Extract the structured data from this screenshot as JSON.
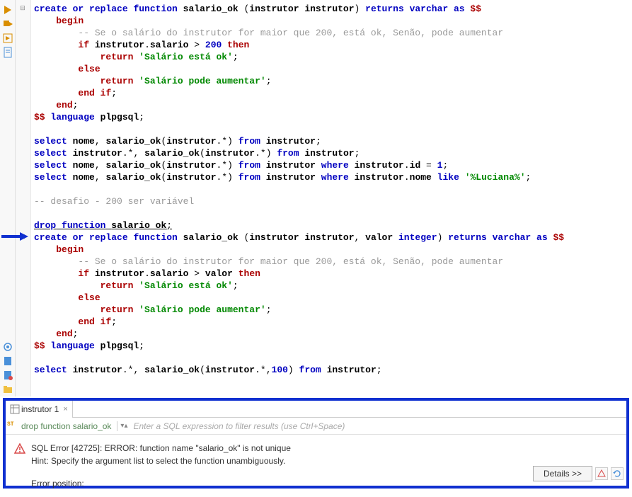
{
  "editor": {
    "lines": [
      [
        [
          "kw-blue",
          "create or replace"
        ],
        [
          "plain",
          " "
        ],
        [
          "kw-blue",
          "function"
        ],
        [
          "plain",
          " "
        ],
        [
          "ident",
          "salario_ok"
        ],
        [
          "plain",
          " ("
        ],
        [
          "ident",
          "instrutor"
        ],
        [
          "plain",
          " "
        ],
        [
          "ident",
          "instrutor"
        ],
        [
          "plain",
          ") "
        ],
        [
          "kw-blue",
          "returns"
        ],
        [
          "plain",
          " "
        ],
        [
          "kw-blue",
          "varchar"
        ],
        [
          "plain",
          " "
        ],
        [
          "kw-blue",
          "as"
        ],
        [
          "plain",
          " "
        ],
        [
          "dollar",
          "$$"
        ]
      ],
      [
        [
          "plain",
          "    "
        ],
        [
          "kw-red",
          "begin"
        ]
      ],
      [
        [
          "plain",
          "        "
        ],
        [
          "comment",
          "-- Se o salário do instrutor for maior que 200, está ok, Senão, pode aumentar"
        ]
      ],
      [
        [
          "plain",
          "        "
        ],
        [
          "kw-red",
          "if"
        ],
        [
          "plain",
          " "
        ],
        [
          "ident",
          "instrutor"
        ],
        [
          "plain",
          "."
        ],
        [
          "ident",
          "salario"
        ],
        [
          "plain",
          " > "
        ],
        [
          "number",
          "200"
        ],
        [
          "plain",
          " "
        ],
        [
          "kw-red",
          "then"
        ]
      ],
      [
        [
          "plain",
          "            "
        ],
        [
          "kw-red",
          "return"
        ],
        [
          "plain",
          " "
        ],
        [
          "string",
          "'Salário está ok'"
        ],
        [
          "plain",
          ";"
        ]
      ],
      [
        [
          "plain",
          "        "
        ],
        [
          "kw-red",
          "else"
        ]
      ],
      [
        [
          "plain",
          "            "
        ],
        [
          "kw-red",
          "return"
        ],
        [
          "plain",
          " "
        ],
        [
          "string",
          "'Salário pode aumentar'"
        ],
        [
          "plain",
          ";"
        ]
      ],
      [
        [
          "plain",
          "        "
        ],
        [
          "kw-red",
          "end"
        ],
        [
          "plain",
          " "
        ],
        [
          "kw-red",
          "if"
        ],
        [
          "plain",
          ";"
        ]
      ],
      [
        [
          "plain",
          "    "
        ],
        [
          "kw-red",
          "end"
        ],
        [
          "plain",
          ";"
        ]
      ],
      [
        [
          "dollar",
          "$$"
        ],
        [
          "plain",
          " "
        ],
        [
          "kw-blue",
          "language"
        ],
        [
          "plain",
          " "
        ],
        [
          "ident",
          "plpgsql"
        ],
        [
          "plain",
          ";"
        ]
      ],
      [
        [
          "plain",
          ""
        ]
      ],
      [
        [
          "kw-blue",
          "select"
        ],
        [
          "plain",
          " "
        ],
        [
          "ident",
          "nome"
        ],
        [
          "plain",
          ", "
        ],
        [
          "ident",
          "salario_ok"
        ],
        [
          "plain",
          "("
        ],
        [
          "ident",
          "instrutor"
        ],
        [
          "plain",
          ".*) "
        ],
        [
          "kw-blue",
          "from"
        ],
        [
          "plain",
          " "
        ],
        [
          "ident",
          "instrutor"
        ],
        [
          "plain",
          ";"
        ]
      ],
      [
        [
          "kw-blue",
          "select"
        ],
        [
          "plain",
          " "
        ],
        [
          "ident",
          "instrutor"
        ],
        [
          "plain",
          ".*, "
        ],
        [
          "ident",
          "salario_ok"
        ],
        [
          "plain",
          "("
        ],
        [
          "ident",
          "instrutor"
        ],
        [
          "plain",
          ".*) "
        ],
        [
          "kw-blue",
          "from"
        ],
        [
          "plain",
          " "
        ],
        [
          "ident",
          "instrutor"
        ],
        [
          "plain",
          ";"
        ]
      ],
      [
        [
          "kw-blue",
          "select"
        ],
        [
          "plain",
          " "
        ],
        [
          "ident",
          "nome"
        ],
        [
          "plain",
          ", "
        ],
        [
          "ident",
          "salario_ok"
        ],
        [
          "plain",
          "("
        ],
        [
          "ident",
          "instrutor"
        ],
        [
          "plain",
          ".*) "
        ],
        [
          "kw-blue",
          "from"
        ],
        [
          "plain",
          " "
        ],
        [
          "ident",
          "instrutor"
        ],
        [
          "plain",
          " "
        ],
        [
          "kw-blue",
          "where"
        ],
        [
          "plain",
          " "
        ],
        [
          "ident",
          "instrutor"
        ],
        [
          "plain",
          "."
        ],
        [
          "ident",
          "id"
        ],
        [
          "plain",
          " = "
        ],
        [
          "number",
          "1"
        ],
        [
          "plain",
          ";"
        ]
      ],
      [
        [
          "kw-blue",
          "select"
        ],
        [
          "plain",
          " "
        ],
        [
          "ident",
          "nome"
        ],
        [
          "plain",
          ", "
        ],
        [
          "ident",
          "salario_ok"
        ],
        [
          "plain",
          "("
        ],
        [
          "ident",
          "instrutor"
        ],
        [
          "plain",
          ".*) "
        ],
        [
          "kw-blue",
          "from"
        ],
        [
          "plain",
          " "
        ],
        [
          "ident",
          "instrutor"
        ],
        [
          "plain",
          " "
        ],
        [
          "kw-blue",
          "where"
        ],
        [
          "plain",
          " "
        ],
        [
          "ident",
          "instrutor"
        ],
        [
          "plain",
          "."
        ],
        [
          "ident",
          "nome"
        ],
        [
          "plain",
          " "
        ],
        [
          "kw-blue",
          "like"
        ],
        [
          "plain",
          " "
        ],
        [
          "string",
          "'%Luciana%'"
        ],
        [
          "plain",
          ";"
        ]
      ],
      [
        [
          "plain",
          ""
        ]
      ],
      [
        [
          "comment",
          "-- desafio - 200 ser variável"
        ]
      ],
      [
        [
          "plain",
          ""
        ]
      ],
      [
        [
          "kw-blue",
          "drop"
        ],
        [
          "plain",
          " "
        ],
        [
          "kw-blue",
          "function"
        ],
        [
          "plain",
          " "
        ],
        [
          "ident",
          "salario_ok"
        ],
        [
          "plain",
          ";"
        ]
      ],
      [
        [
          "kw-blue",
          "create or replace"
        ],
        [
          "plain",
          " "
        ],
        [
          "kw-blue",
          "function"
        ],
        [
          "plain",
          " "
        ],
        [
          "ident",
          "salario_ok"
        ],
        [
          "plain",
          " ("
        ],
        [
          "ident",
          "instrutor"
        ],
        [
          "plain",
          " "
        ],
        [
          "ident",
          "instrutor"
        ],
        [
          "plain",
          ", "
        ],
        [
          "ident",
          "valor"
        ],
        [
          "plain",
          " "
        ],
        [
          "kw-blue",
          "integer"
        ],
        [
          "plain",
          ") "
        ],
        [
          "kw-blue",
          "returns"
        ],
        [
          "plain",
          " "
        ],
        [
          "kw-blue",
          "varchar"
        ],
        [
          "plain",
          " "
        ],
        [
          "kw-blue",
          "as"
        ],
        [
          "plain",
          " "
        ],
        [
          "dollar",
          "$$"
        ]
      ],
      [
        [
          "plain",
          "    "
        ],
        [
          "kw-red",
          "begin"
        ]
      ],
      [
        [
          "plain",
          "        "
        ],
        [
          "comment",
          "-- Se o salário do instrutor for maior que 200, está ok, Senão, pode aumentar"
        ]
      ],
      [
        [
          "plain",
          "        "
        ],
        [
          "kw-red",
          "if"
        ],
        [
          "plain",
          " "
        ],
        [
          "ident",
          "instrutor"
        ],
        [
          "plain",
          "."
        ],
        [
          "ident",
          "salario"
        ],
        [
          "plain",
          " > "
        ],
        [
          "ident",
          "valor"
        ],
        [
          "plain",
          " "
        ],
        [
          "kw-red",
          "then"
        ]
      ],
      [
        [
          "plain",
          "            "
        ],
        [
          "kw-red",
          "return"
        ],
        [
          "plain",
          " "
        ],
        [
          "string",
          "'Salário está ok'"
        ],
        [
          "plain",
          ";"
        ]
      ],
      [
        [
          "plain",
          "        "
        ],
        [
          "kw-red",
          "else"
        ]
      ],
      [
        [
          "plain",
          "            "
        ],
        [
          "kw-red",
          "return"
        ],
        [
          "plain",
          " "
        ],
        [
          "string",
          "'Salário pode aumentar'"
        ],
        [
          "plain",
          ";"
        ]
      ],
      [
        [
          "plain",
          "        "
        ],
        [
          "kw-red",
          "end"
        ],
        [
          "plain",
          " "
        ],
        [
          "kw-red",
          "if"
        ],
        [
          "plain",
          ";"
        ]
      ],
      [
        [
          "plain",
          "    "
        ],
        [
          "kw-red",
          "end"
        ],
        [
          "plain",
          ";"
        ]
      ],
      [
        [
          "dollar",
          "$$"
        ],
        [
          "plain",
          " "
        ],
        [
          "kw-blue",
          "language"
        ],
        [
          "plain",
          " "
        ],
        [
          "ident",
          "plpgsql"
        ],
        [
          "plain",
          ";"
        ]
      ],
      [
        [
          "plain",
          ""
        ]
      ],
      [
        [
          "kw-blue",
          "select"
        ],
        [
          "plain",
          " "
        ],
        [
          "ident",
          "instrutor"
        ],
        [
          "plain",
          ".*, "
        ],
        [
          "ident",
          "salario_ok"
        ],
        [
          "plain",
          "("
        ],
        [
          "ident",
          "instrutor"
        ],
        [
          "plain",
          ".*,"
        ],
        [
          "number",
          "100"
        ],
        [
          "plain",
          ") "
        ],
        [
          "kw-blue",
          "from"
        ],
        [
          "plain",
          " "
        ],
        [
          "ident",
          "instrutor"
        ],
        [
          "plain",
          ";"
        ]
      ]
    ],
    "fold_markers": [
      0,
      19
    ],
    "current_line_index": 18
  },
  "results": {
    "tab_label": "instrutor 1",
    "executed_sql": "drop function salario_ok",
    "filter_placeholder": "Enter a SQL expression to filter results (use Ctrl+Space)",
    "error_line1": "SQL Error [42725]: ERROR: function name \"salario_ok\" is not unique",
    "error_line2": "Hint: Specify the argument list to select the function unambiguously.",
    "error_position_label": "Error position:",
    "details_button": "Details >>"
  }
}
